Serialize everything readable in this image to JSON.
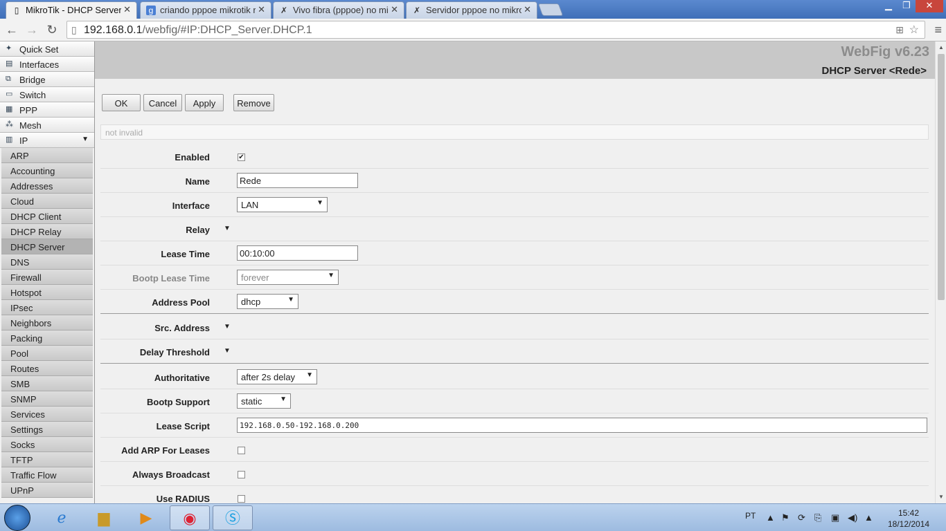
{
  "browser": {
    "tabs": [
      {
        "title": "MikroTik - DHCP Server <",
        "icon": "document-icon",
        "active": true
      },
      {
        "title": "criando pppoe mikrotik rb",
        "icon": "google-icon",
        "active": false
      },
      {
        "title": "Vivo fibra (pppoe) no mikr",
        "icon": "mikrotik-icon",
        "active": false
      },
      {
        "title": "Servidor pppoe no mikrotik",
        "icon": "mikrotik-icon",
        "active": false
      }
    ],
    "url_host": "192.168.0.1",
    "url_rest": "/webfig/#IP:DHCP_Server.DHCP.1"
  },
  "sidebar": {
    "top_items": [
      {
        "label": "Quick Set",
        "icon": "wand-icon"
      },
      {
        "label": "Interfaces",
        "icon": "interfaces-icon"
      },
      {
        "label": "Bridge",
        "icon": "bridge-icon"
      },
      {
        "label": "Switch",
        "icon": "switch-icon"
      },
      {
        "label": "PPP",
        "icon": "ppp-icon"
      },
      {
        "label": "Mesh",
        "icon": "mesh-icon"
      },
      {
        "label": "IP",
        "icon": "ip-icon"
      }
    ],
    "ip_sub_items": [
      "ARP",
      "Accounting",
      "Addresses",
      "Cloud",
      "DHCP Client",
      "DHCP Relay",
      "DHCP Server",
      "DNS",
      "Firewall",
      "Hotspot",
      "IPsec",
      "Neighbors",
      "Packing",
      "Pool",
      "Routes",
      "SMB",
      "SNMP",
      "Services",
      "Settings",
      "Socks",
      "TFTP",
      "Traffic Flow",
      "UPnP"
    ],
    "active_sub": "DHCP Server"
  },
  "header": {
    "brand": "WebFig v6.23",
    "title": "DHCP Server <Rede>"
  },
  "actions": {
    "ok": "OK",
    "cancel": "Cancel",
    "apply": "Apply",
    "remove": "Remove"
  },
  "status": "not invalid",
  "form": {
    "enabled_label": "Enabled",
    "enabled_checked": true,
    "name_label": "Name",
    "name_value": "Rede",
    "interface_label": "Interface",
    "interface_value": "LAN",
    "relay_label": "Relay",
    "lease_time_label": "Lease Time",
    "lease_time_value": "00:10:00",
    "bootp_lease_label": "Bootp Lease Time",
    "bootp_lease_value": "forever",
    "address_pool_label": "Address Pool",
    "address_pool_value": "dhcp",
    "src_address_label": "Src. Address",
    "delay_threshold_label": "Delay Threshold",
    "authoritative_label": "Authoritative",
    "authoritative_value": "after 2s delay",
    "bootp_support_label": "Bootp Support",
    "bootp_support_value": "static",
    "lease_script_label": "Lease Script",
    "lease_script_value": "192.168.0.50-192.168.0.200",
    "add_arp_label": "Add ARP For Leases",
    "always_broadcast_label": "Always Broadcast",
    "use_radius_label": "Use RADIUS"
  },
  "taskbar": {
    "language": "PT",
    "time": "15:42",
    "date": "18/12/2014"
  }
}
